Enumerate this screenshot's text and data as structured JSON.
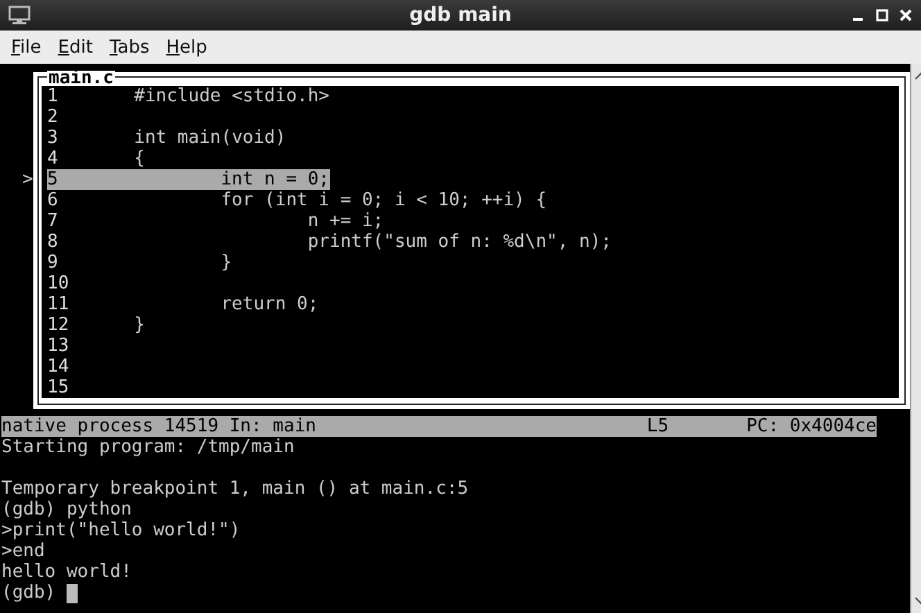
{
  "window": {
    "title": "gdb main"
  },
  "menu": [
    {
      "label": "File"
    },
    {
      "label": "Edit"
    },
    {
      "label": "Tabs"
    },
    {
      "label": "Help"
    }
  ],
  "source_window": {
    "title": "main.c",
    "marker": ">",
    "lines": [
      {
        "number": "1",
        "code": "\t#include <stdio.h>",
        "selected": false
      },
      {
        "number": "2",
        "selected": false
      },
      {
        "number": "3",
        "code": "\tint main(void)",
        "selected": false
      },
      {
        "number": "4",
        "code": "\t{",
        "selected": false
      },
      {
        "number": "5",
        "code": "\t\tint n = 0;",
        "selected": true
      },
      {
        "number": "6",
        "code": "\t\tfor (int i = 0; i < 10; ++i) {",
        "selected": false
      },
      {
        "number": "7",
        "code": "\t\t\tn += i;",
        "selected": false
      },
      {
        "number": "8",
        "code": "\t\t\tprintf(\"sum of n: %d\\n\", n);",
        "selected": false
      },
      {
        "number": "9",
        "code": "\t\t}",
        "selected": false
      },
      {
        "number": "10",
        "selected": false
      },
      {
        "number": "11",
        "code": "\t\treturn 0;",
        "selected": false
      },
      {
        "number": "12",
        "code": "\t}",
        "selected": false
      },
      {
        "number": "13",
        "selected": false
      },
      {
        "number": "14",
        "selected": false
      },
      {
        "number": "15",
        "selected": false
      }
    ]
  },
  "status_bar": {
    "process": "native process 14519 In: main",
    "line": "L5",
    "pc": "PC: 0x4004ce"
  },
  "console": {
    "lines": [
      {
        "kind": "text",
        "text": "Starting program: /tmp/main"
      },
      {
        "kind": "blank"
      },
      {
        "kind": "text",
        "text": "Temporary breakpoint 1, main () at main.c:5"
      },
      {
        "kind": "text",
        "text": "(gdb) python"
      },
      {
        "kind": "text",
        "text": ">print(\"hello world!\")"
      },
      {
        "kind": "text",
        "text": ">end"
      },
      {
        "kind": "text",
        "text": "hello world!"
      }
    ],
    "prompt": "(gdb)"
  }
}
